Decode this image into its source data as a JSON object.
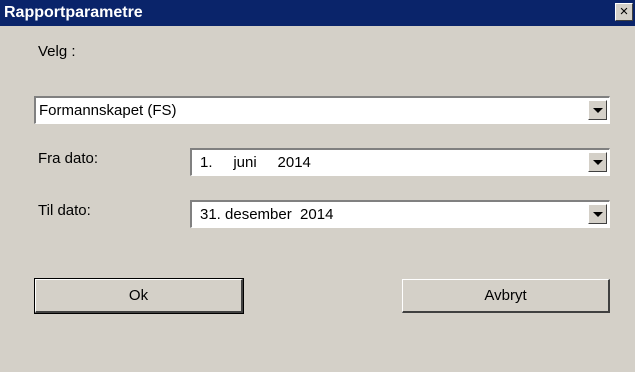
{
  "window": {
    "title": "Rapportparametre",
    "close_symbol": "×"
  },
  "form": {
    "select_label": "Velg :",
    "select_value": "Formannskapet (FS)",
    "from_label": "Fra dato:",
    "from_value": "1.     juni     2014",
    "to_label": "Til dato:",
    "to_value": "31. desember  2014"
  },
  "buttons": {
    "ok_label": "Ok",
    "cancel_label": "Avbryt"
  }
}
